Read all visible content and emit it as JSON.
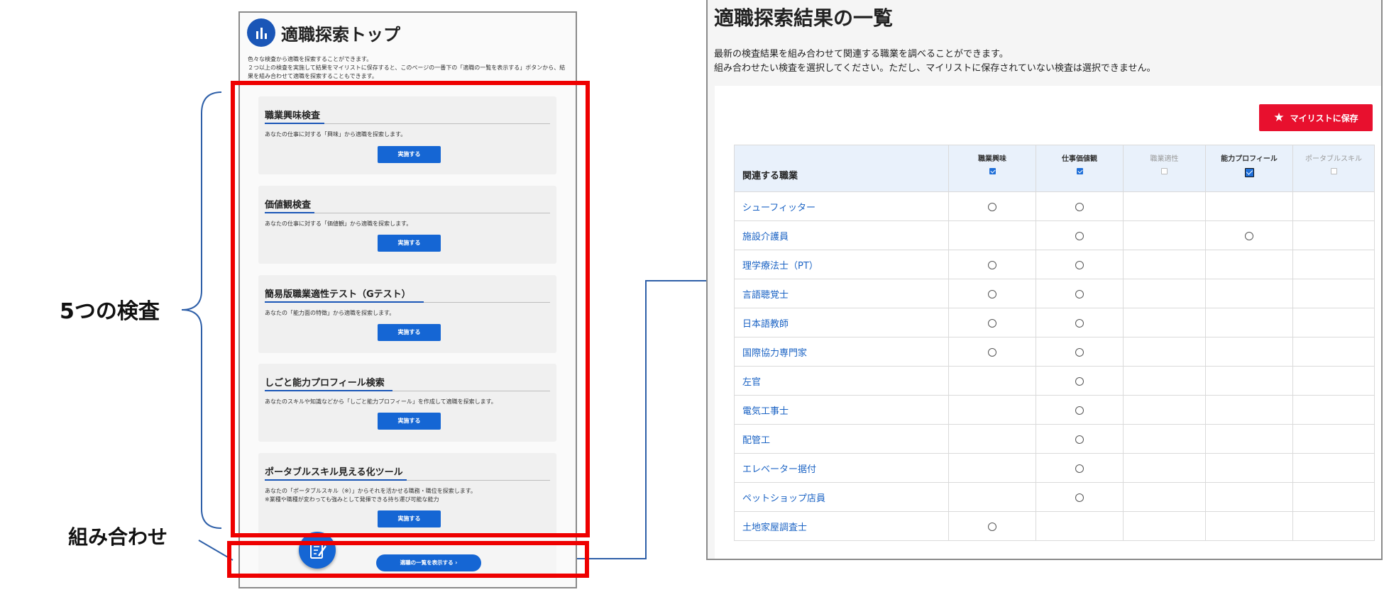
{
  "annotations": {
    "five_tests": "5つの検査",
    "combination": "組み合わせ"
  },
  "left_panel": {
    "title": "適職探索トップ",
    "intro_line1": "色々な検査から適職を探索することができます。",
    "intro_line2": "２つ以上の検査を実施して結果をマイリストに保存すると、このページの一番下の「適職の一覧を表示する」ボタンから、結果を組み合わせて適職を探索することもできます。",
    "cards": [
      {
        "title": "職業興味検査",
        "desc": "あなたの仕事に対する「興味」から適職を探索します。",
        "button": "実施する"
      },
      {
        "title": "価値観検査",
        "desc": "あなたの仕事に対する「価値観」から適職を探索します。",
        "button": "実施する"
      },
      {
        "title": "簡易版職業適性テスト（Gテスト）",
        "desc": "あなたの「能力面の特徴」から適職を探索します。",
        "button": "実施する"
      },
      {
        "title": "しごと能力プロフィール検索",
        "desc": "あなたのスキルや知識などから「しごと能力プロフィール」を作成して適職を探索します。",
        "button": "実施する"
      },
      {
        "title": "ポータブルスキル見える化ツール",
        "desc": "あなたの「ポータブルスキル（※）」からそれを活かせる職務・職位を探索します。",
        "desc2": "※業種や職種が変わっても強みとして発揮できる持ち運び可能な能力",
        "button": "実施する"
      }
    ],
    "combo_button": "適職の一覧を表示する",
    "combo_arrow": "›",
    "fab_icon": "checklist-pen-icon"
  },
  "right_panel": {
    "title": "適職探索結果の一覧",
    "desc_line1": "最新の検査結果を組み合わせて関連する職業を調べることができます。",
    "desc_line2": "組み合わせたい検査を選択してください。ただし、マイリストに保存されていない検査は選択できません。",
    "save_button": "マイリストに保存",
    "save_icon": "star-icon",
    "table": {
      "first_header": "関連する職業",
      "columns": [
        {
          "label": "職業興味",
          "checked": true,
          "enabled": true
        },
        {
          "label": "仕事価値観",
          "checked": true,
          "enabled": true
        },
        {
          "label": "職業適性",
          "checked": false,
          "enabled": false
        },
        {
          "label": "能力プロフィール",
          "checked": true,
          "enabled": true
        },
        {
          "label": "ポータブルスキル",
          "checked": false,
          "enabled": false
        }
      ],
      "rows": [
        {
          "job": "シューフィッター",
          "marks": [
            true,
            true,
            false,
            false,
            false
          ]
        },
        {
          "job": "施設介護員",
          "marks": [
            false,
            true,
            false,
            true,
            false
          ]
        },
        {
          "job": "理学療法士（PT）",
          "marks": [
            true,
            true,
            false,
            false,
            false
          ]
        },
        {
          "job": "言語聴覚士",
          "marks": [
            true,
            true,
            false,
            false,
            false
          ]
        },
        {
          "job": "日本語教師",
          "marks": [
            true,
            true,
            false,
            false,
            false
          ]
        },
        {
          "job": "国際協力専門家",
          "marks": [
            true,
            true,
            false,
            false,
            false
          ]
        },
        {
          "job": "左官",
          "marks": [
            false,
            true,
            false,
            false,
            false
          ]
        },
        {
          "job": "電気工事士",
          "marks": [
            false,
            true,
            false,
            false,
            false
          ]
        },
        {
          "job": "配管工",
          "marks": [
            false,
            true,
            false,
            false,
            false
          ]
        },
        {
          "job": "エレベーター据付",
          "marks": [
            false,
            true,
            false,
            false,
            false
          ]
        },
        {
          "job": "ペットショップ店員",
          "marks": [
            false,
            true,
            false,
            false,
            false
          ]
        },
        {
          "job": "土地家屋調査士",
          "marks": [
            true,
            false,
            false,
            false,
            false
          ]
        }
      ]
    }
  }
}
